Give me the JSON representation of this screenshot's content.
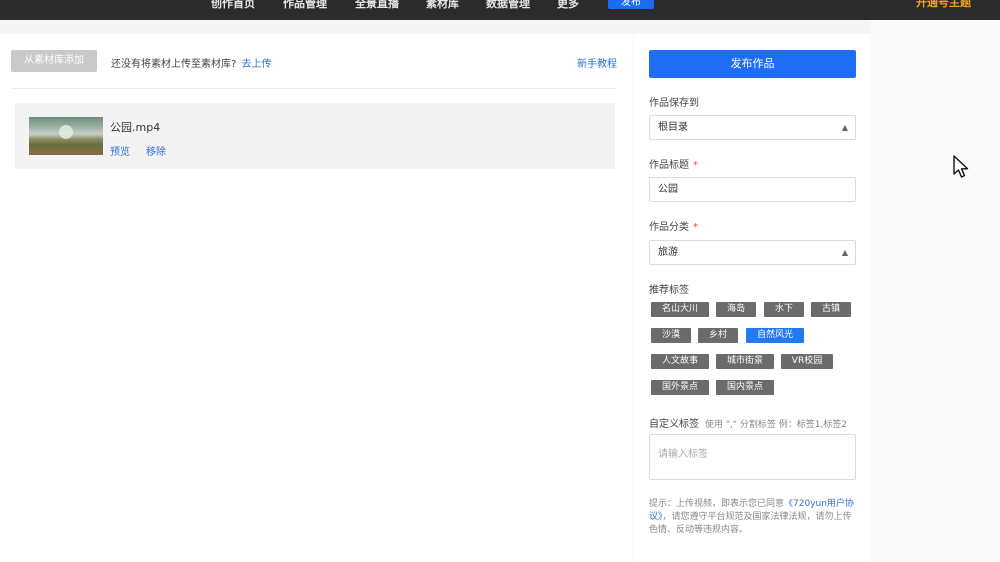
{
  "topnav": {
    "items": [
      "创作首页",
      "作品管理",
      "全景直播",
      "素材库",
      "数据管理",
      "更多"
    ],
    "publish_label": "发布",
    "login_label": "开通号主题"
  },
  "upload_bar": {
    "from_library_label": "从素材库添加",
    "hint_text": "还没有将素材上传至素材库?",
    "upload_link": "去上传",
    "tutorial_link": "新手教程"
  },
  "file": {
    "name": "公园.mp4",
    "preview_label": "预览",
    "remove_label": "移除"
  },
  "form": {
    "publish_button": "发布作品",
    "save_to_label": "作品保存到",
    "save_to_value": "根目录",
    "title_label": "作品标题",
    "title_value": "公园",
    "category_label": "作品分类",
    "category_value": "旅游",
    "required_mark": "*",
    "tags_label": "推荐标签",
    "tags": [
      {
        "label": "名山大川",
        "active": false
      },
      {
        "label": "海岛",
        "active": false
      },
      {
        "label": "水下",
        "active": false
      },
      {
        "label": "古镇",
        "active": false
      },
      {
        "label": "沙漠",
        "active": false
      },
      {
        "label": "乡村",
        "active": false
      },
      {
        "label": "自然风光",
        "active": true
      },
      {
        "label": "人文故事",
        "active": false
      },
      {
        "label": "城市街景",
        "active": false
      },
      {
        "label": "VR校园",
        "active": false
      },
      {
        "label": "国外景点",
        "active": false
      },
      {
        "label": "国内景点",
        "active": false
      }
    ],
    "custom_tags_label": "自定义标签",
    "custom_tags_hint": "使用 \",\" 分割标签 例：标签1,标签2",
    "custom_tags_placeholder": "请输入标签",
    "tip_prefix": "提示：上传视频，即表示您已同意",
    "tip_link": "《720yun用户协议》",
    "tip_suffix": "，请您遵守平台规范及国家法律法规，请勿上传色情、反动等违规内容。"
  },
  "colors": {
    "accent": "#1f6df2",
    "link": "#2d6fd8",
    "tag_active": "#2478f0",
    "tag_default": "#6b6b6b",
    "topbar": "#2b2b2b",
    "required": "#e64b3c"
  }
}
